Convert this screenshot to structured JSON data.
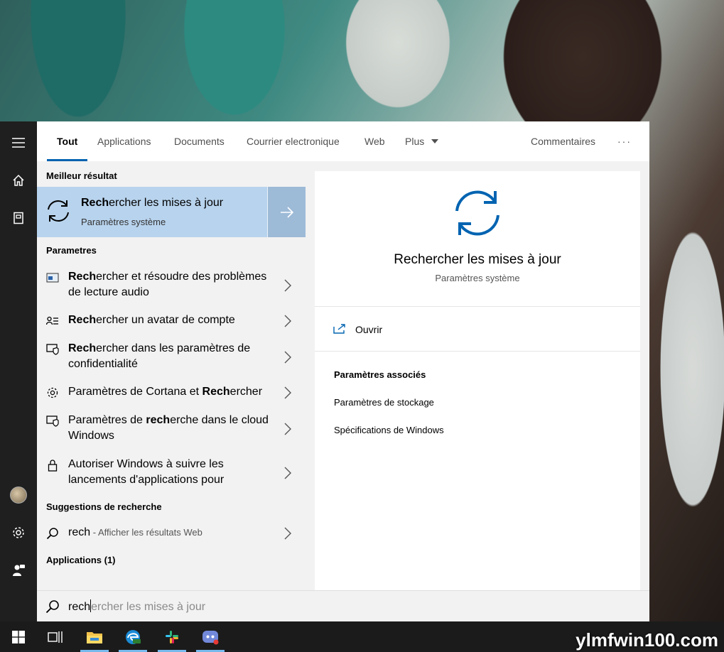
{
  "tabs": [
    {
      "label": "Tout"
    },
    {
      "label": "Applications"
    },
    {
      "label": "Documents"
    },
    {
      "label": "Courrier electronique"
    },
    {
      "label": "Web"
    },
    {
      "label": "Plus"
    }
  ],
  "toolbar": {
    "feedback_label": "Commentaires",
    "more_label": "···"
  },
  "sections": {
    "best": "Meilleur résultat",
    "settings": "Parametres",
    "suggestions": "Suggestions de recherche",
    "apps": "Applications (1)"
  },
  "best_result": {
    "title_bold": "Rech",
    "title_rest": "ercher les mises à jour",
    "subtitle": "Paramètres système",
    "icon": "sync-icon"
  },
  "settings_items": [
    {
      "pre": "",
      "bold": "Rech",
      "post": "ercher et résoudre des problèmes de lecture audio",
      "icon": "troubleshoot-icon"
    },
    {
      "pre": "",
      "bold": "Rech",
      "post": "ercher un avatar de compte",
      "icon": "account-icon"
    },
    {
      "pre": "",
      "bold": "Rech",
      "post": "ercher dans les paramètres de confidentialité",
      "icon": "shield-icon"
    },
    {
      "pre": "Paramètres de Cortana et ",
      "bold": "Rech",
      "post": "ercher",
      "icon": "gear-icon"
    },
    {
      "pre": "Paramètres de ",
      "bold": "rech",
      "post": "erche dans le cloud Windows",
      "icon": "shield-icon"
    },
    {
      "pre": "Autoriser Windows à suivre les lancements d'applications pour",
      "bold": "",
      "post": "",
      "icon": "lock-icon"
    }
  ],
  "suggestion": {
    "query": "rech",
    "hint": " - Afficher les résultats Web",
    "icon": "search-icon"
  },
  "preview": {
    "title": "Rechercher les mises à jour",
    "subtitle": "Paramètres système",
    "open_label": "Ouvrir",
    "related_title": "Paramètres associés",
    "related": [
      "Paramètres de stockage",
      "Spécifications de Windows"
    ]
  },
  "search": {
    "typed": "rech",
    "suggestion_rest": "ercher les mises à jour"
  },
  "watermark": "ylmfwin100.com",
  "colors": {
    "accent": "#0063b1",
    "selected_bg": "#b8d3ed",
    "rail_bg": "#1f1f1f",
    "taskbar_bg": "#1b1b1b"
  }
}
